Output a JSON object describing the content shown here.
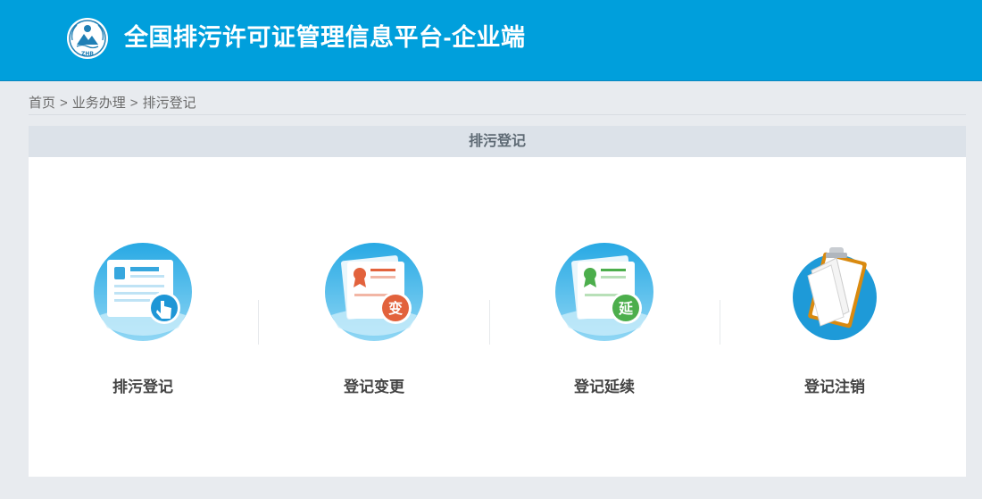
{
  "header": {
    "title": "全国排污许可证管理信息平台-企业端",
    "logo_text": "ZHB",
    "logo_icon": "environment-emblem-icon"
  },
  "breadcrumb": {
    "items": [
      "首页",
      "业务办理",
      "排污登记"
    ],
    "separator": ">"
  },
  "panel": {
    "title": "排污登记"
  },
  "tiles": [
    {
      "label": "排污登记",
      "icon": "id-card-hand-icon"
    },
    {
      "label": "登记变更",
      "icon": "certificate-change-icon",
      "badge": "变"
    },
    {
      "label": "登记延续",
      "icon": "certificate-renew-icon",
      "badge": "延"
    },
    {
      "label": "登记注销",
      "icon": "clipboard-cancel-icon"
    }
  ],
  "colors": {
    "header_bg": "#009fdc",
    "page_bg": "#e8ebef",
    "panel_header_bg": "#dce2e9",
    "badge_change": "#e2623c",
    "badge_renew": "#4cae4c"
  }
}
